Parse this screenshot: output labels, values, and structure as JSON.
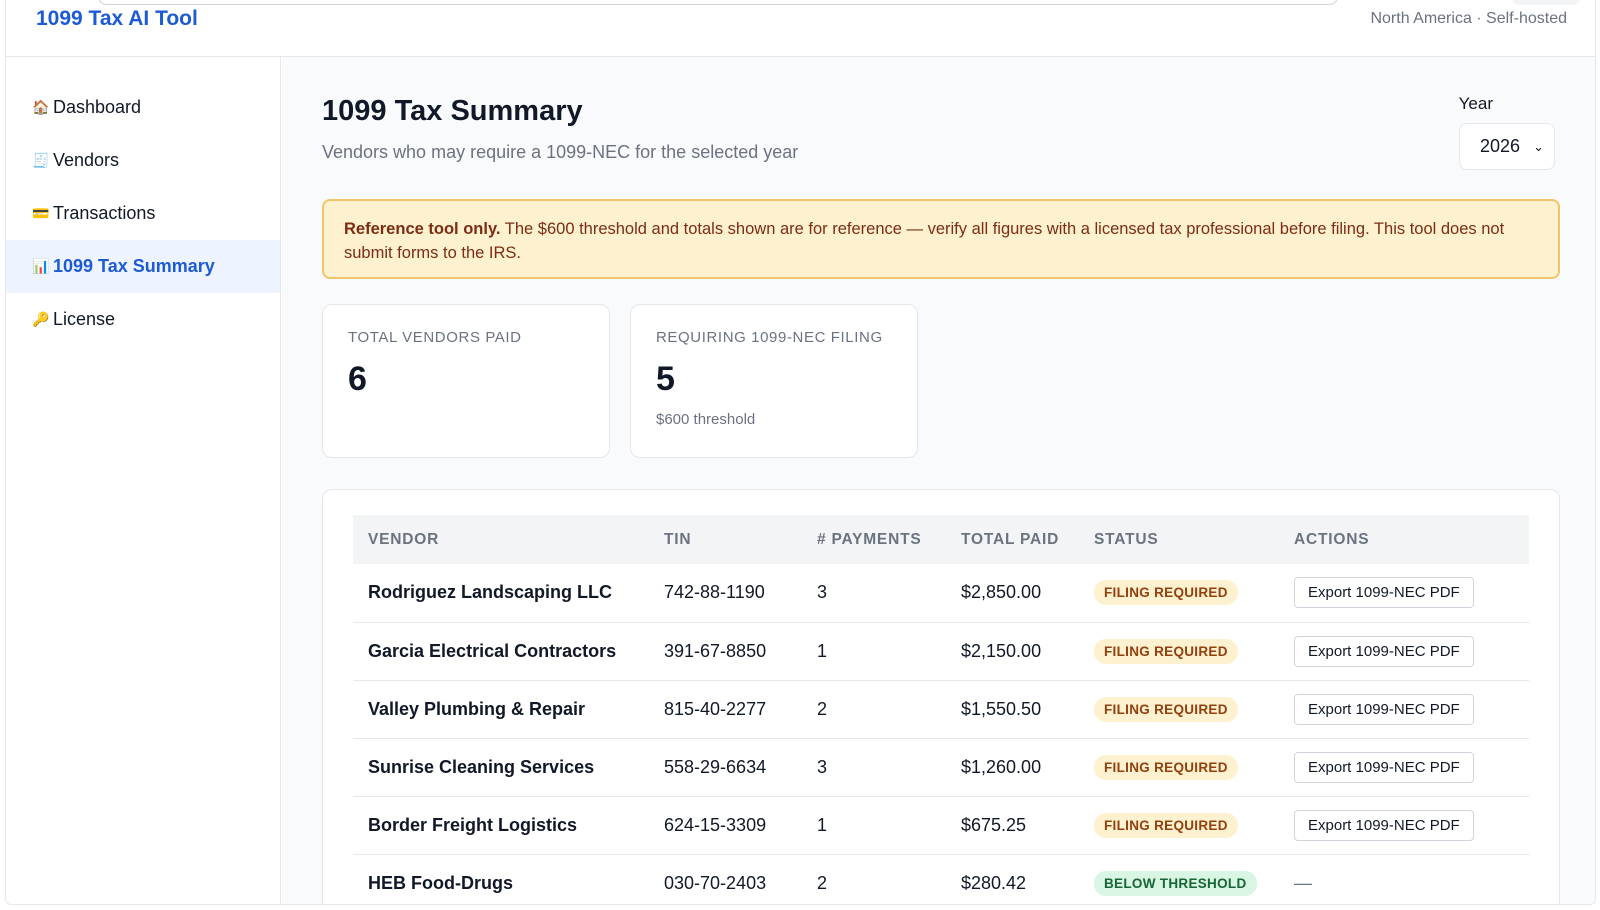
{
  "app": {
    "brand": "1099 Tax AI Tool",
    "region": "North America · Self-hosted"
  },
  "sidebar": {
    "items": [
      {
        "icon": "house-icon",
        "glyph": "🏠",
        "label": "Dashboard"
      },
      {
        "icon": "receipt-icon",
        "glyph": "🧾",
        "label": "Vendors"
      },
      {
        "icon": "credit-card-icon",
        "glyph": "💳",
        "label": "Transactions"
      },
      {
        "icon": "bar-chart-icon",
        "glyph": "📊",
        "label": "1099 Tax Summary"
      },
      {
        "icon": "key-icon",
        "glyph": "🔑",
        "label": "License"
      }
    ],
    "active_index": 3
  },
  "page": {
    "title": "1099 Tax Summary",
    "subtitle": "Vendors who may require a 1099-NEC for the selected year",
    "year_label": "Year",
    "year_value": "2026"
  },
  "notice": {
    "bold": "Reference tool only.",
    "text": " The $600 threshold and totals shown are for reference — verify all figures with a licensed tax professional before filing. This tool does not submit forms to the IRS."
  },
  "cards": {
    "total_vendors": {
      "label": "Total vendors paid",
      "value": "6"
    },
    "requiring": {
      "label": "Requiring 1099-NEC filing",
      "value": "5",
      "note": "$600 threshold"
    }
  },
  "table": {
    "headers": [
      "Vendor",
      "TIN",
      "# Payments",
      "Total Paid",
      "Status",
      "Actions"
    ],
    "rows": [
      {
        "vendor": "Rodriguez Landscaping LLC",
        "tin": "742-88-1190",
        "payments": "3",
        "total": "$2,850.00",
        "status": "FILING REQUIRED",
        "status_type": "req",
        "action": "Export 1099-NEC PDF"
      },
      {
        "vendor": "Garcia Electrical Contractors",
        "tin": "391-67-8850",
        "payments": "1",
        "total": "$2,150.00",
        "status": "FILING REQUIRED",
        "status_type": "req",
        "action": "Export 1099-NEC PDF"
      },
      {
        "vendor": "Valley Plumbing & Repair",
        "tin": "815-40-2277",
        "payments": "2",
        "total": "$1,550.50",
        "status": "FILING REQUIRED",
        "status_type": "req",
        "action": "Export 1099-NEC PDF"
      },
      {
        "vendor": "Sunrise Cleaning Services",
        "tin": "558-29-6634",
        "payments": "3",
        "total": "$1,260.00",
        "status": "FILING REQUIRED",
        "status_type": "req",
        "action": "Export 1099-NEC PDF"
      },
      {
        "vendor": "Border Freight Logistics",
        "tin": "624-15-3309",
        "payments": "1",
        "total": "$675.25",
        "status": "FILING REQUIRED",
        "status_type": "req",
        "action": "Export 1099-NEC PDF"
      },
      {
        "vendor": "HEB Food-Drugs",
        "tin": "030-70-2403",
        "payments": "2",
        "total": "$280.42",
        "status": "BELOW THRESHOLD",
        "status_type": "below",
        "action": "—"
      }
    ]
  },
  "colors": {
    "accent": "#1d5bd6",
    "warning_bg": "#fdf1d0",
    "warning_border": "#f2c46b",
    "success_bg": "#d9f5e3"
  }
}
